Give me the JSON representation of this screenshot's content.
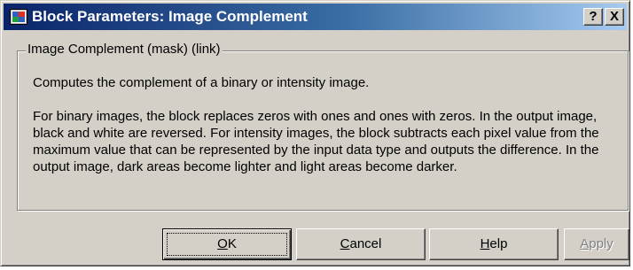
{
  "window": {
    "title": "Block Parameters: Image Complement",
    "help_button": "?",
    "close_button": "X"
  },
  "group": {
    "label": "Image Complement (mask) (link)",
    "description_1": "Computes the complement of a binary or intensity image.",
    "description_2": "For binary images, the block replaces zeros with ones and ones with zeros.  In the output image, black and white are reversed. For intensity images, the block subtracts each pixel value from the maximum value that can be represented by the input data type and outputs the difference.  In the output image, dark areas become lighter and light areas become darker."
  },
  "buttons": {
    "ok": {
      "label_first": "O",
      "label_rest": "K"
    },
    "cancel": {
      "label_first": "C",
      "label_rest": "ancel"
    },
    "help": {
      "label_first": "H",
      "label_rest": "elp"
    },
    "apply": {
      "label_first": "A",
      "label_rest": "pply",
      "enabled": false
    }
  },
  "colors": {
    "dialog_bg": "#d4d0c8",
    "titlebar_start": "#0a246a",
    "titlebar_end": "#a6caf0"
  },
  "icons": {
    "title": "simulink-block-icon"
  }
}
